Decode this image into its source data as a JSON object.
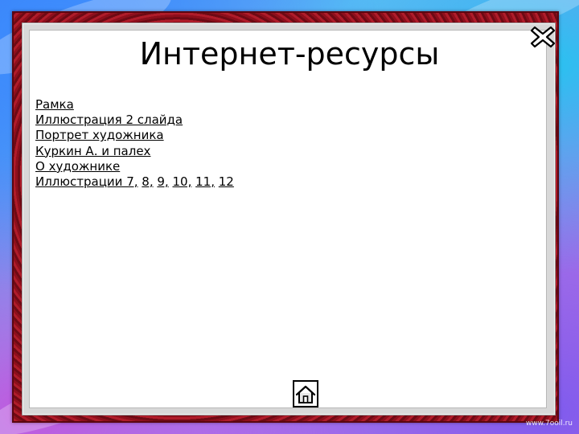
{
  "slide": {
    "title": "Интернет-ресурсы",
    "links": [
      "Рамка",
      "Иллюстрация 2 слайда",
      "Портрет художника",
      "Куркин А. и палех",
      "О художнике"
    ],
    "illustrations": {
      "prefix": "Иллюстрации 7,",
      "items": [
        "8,",
        "9,",
        "10,",
        "11,",
        "12"
      ]
    }
  },
  "controls": {
    "close_icon": "close-x-icon",
    "home_icon": "home-icon"
  },
  "watermark": "www.7ooil.ru",
  "colors": {
    "frame": "#8b1020",
    "panel": "#ffffff",
    "text": "#000000"
  }
}
